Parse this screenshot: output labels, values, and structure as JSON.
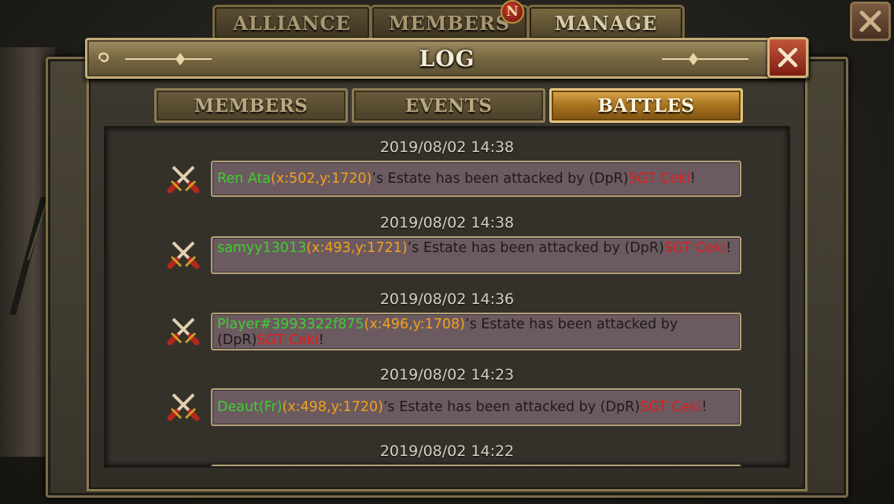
{
  "top_tabs": [
    {
      "label": "ALLIANCE"
    },
    {
      "label": "MEMBERS"
    },
    {
      "label": "MANAGE"
    }
  ],
  "badge": "N",
  "title": "LOG",
  "sub_tabs": [
    {
      "label": "MEMBERS"
    },
    {
      "label": "EVENTS"
    },
    {
      "label": "BATTLES"
    }
  ],
  "log_entries": [
    {
      "timestamp": "2019/08/02 14:38",
      "name": "Ren Ata",
      "coords": "(x:502,y:1720)",
      "text": "’s Estate has been attacked by (DpR)",
      "attacker": "SGT Ceki",
      "end": "!"
    },
    {
      "timestamp": "2019/08/02 14:38",
      "name": "samyy13013",
      "coords": "(x:493,y:1721)",
      "text": "’s Estate has been attacked by (DpR)",
      "attacker": "SGT Ceki",
      "end": "!"
    },
    {
      "timestamp": "2019/08/02 14:36",
      "name": "Player#3993322f875",
      "coords": "(x:496,y:1708)",
      "text": "’s Estate has been attacked by (DpR)",
      "attacker": "SGT Ceki",
      "end": "!"
    },
    {
      "timestamp": "2019/08/02 14:23",
      "name": "Deaut(Fr)",
      "coords": "(x:498,y:1720)",
      "text": "’s Estate has been attacked by (DpR)",
      "attacker": "SGT Ceki",
      "end": "!"
    },
    {
      "timestamp": "2019/08/02 14:22"
    }
  ],
  "icons": {
    "close": "close-x-icon",
    "battle": "crossed-swords-icon"
  },
  "colors": {
    "name": "#3fcf2f",
    "coords": "#f0a21b",
    "attacker": "#e31b1b",
    "active_tab": "#c08a33"
  }
}
